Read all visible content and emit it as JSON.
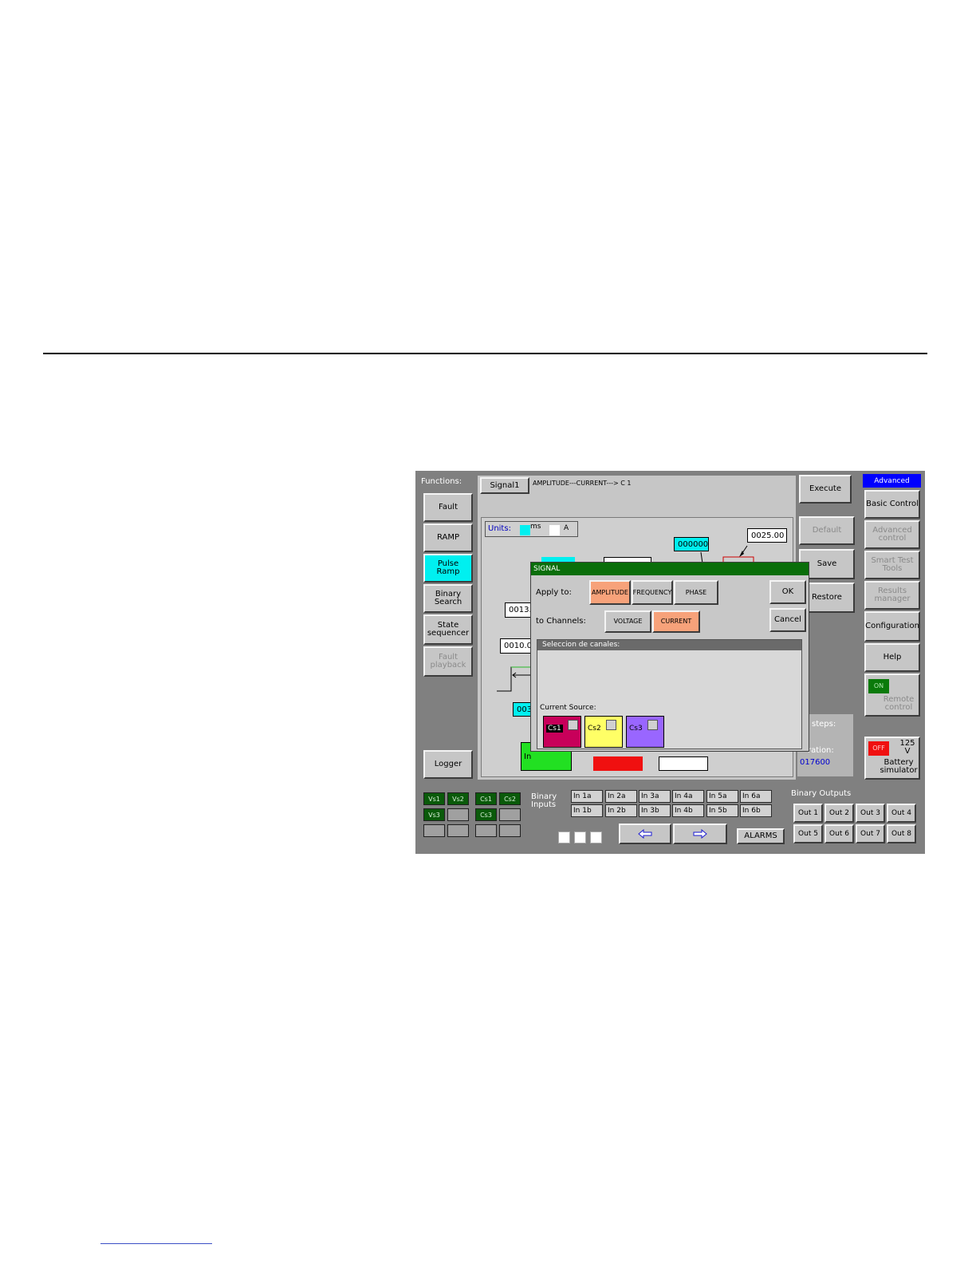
{
  "functions": {
    "title": "Functions:",
    "items": [
      {
        "label": "Fault",
        "state": "normal"
      },
      {
        "label": "RAMP",
        "state": "normal"
      },
      {
        "label": "Pulse Ramp",
        "state": "selected"
      },
      {
        "label": "Binary Search",
        "state": "normal"
      },
      {
        "label": "State sequencer",
        "state": "normal"
      },
      {
        "label": "Fault playback",
        "state": "disabled"
      }
    ],
    "logger": "Logger"
  },
  "header": {
    "signal_button": "Signal1",
    "path_text": "AMPLITUDE---CURRENT---> C 1"
  },
  "actions": {
    "execute": "Execute",
    "default": "Default",
    "save": "Save",
    "restore": "Restore"
  },
  "units": {
    "label": "Units:",
    "time_unit": "ms",
    "value_unit": "A"
  },
  "diagram": {
    "field_top_cyan": "000000",
    "field_top_right": "0025.00",
    "field_left_1": "0013.",
    "field_left_2": "0010.0",
    "field_left_3": "003",
    "box_letter": "In"
  },
  "info_panel": {
    "steps_label": "steps:",
    "duration_label": "ration:",
    "duration_value": "017600"
  },
  "right_menu": {
    "mode": "Advanced",
    "items": [
      {
        "label": "Basic Control",
        "state": "normal"
      },
      {
        "label": "Advanced control",
        "state": "disabled"
      },
      {
        "label": "Smart Test Tools",
        "state": "disabled"
      },
      {
        "label": "Results manager",
        "state": "disabled"
      },
      {
        "label": "Configuration",
        "state": "normal"
      },
      {
        "label": "Help",
        "state": "normal"
      }
    ],
    "remote": {
      "indicator": "ON",
      "label": "Remote control"
    },
    "battery": {
      "indicator": "OFF",
      "voltage": "125 V",
      "label": "Battery simulator"
    }
  },
  "dialog": {
    "title": "SIGNAL",
    "apply_to_label": "Apply to:",
    "apply_options": [
      {
        "label": "AMPLITUDE",
        "selected": true
      },
      {
        "label": "FREQUENCY",
        "selected": false
      },
      {
        "label": "PHASE",
        "selected": false
      }
    ],
    "channels_label": "to Channels:",
    "channel_options": [
      {
        "label": "VOLTAGE",
        "selected": false
      },
      {
        "label": "CURRENT",
        "selected": true
      }
    ],
    "ok": "OK",
    "cancel": "Cancel",
    "group_title": "Seleccion de canales:",
    "source_label": "Current Source:",
    "sources": [
      {
        "label": "Cs1",
        "color": "#c8005a",
        "highlighted": true
      },
      {
        "label": "Cs2",
        "color": "#ffff66",
        "highlighted": false
      },
      {
        "label": "Cs3",
        "color": "#9966ff",
        "highlighted": false
      }
    ]
  },
  "status": {
    "voltage_sources": [
      "Vs1",
      "Vs2",
      "Vs3"
    ],
    "current_sources": [
      "Cs1",
      "Cs2",
      "Cs3"
    ],
    "binary_inputs_label": "Binary Inputs",
    "binary_inputs": [
      "In 1a",
      "In 2a",
      "In 3a",
      "In 4a",
      "In 5a",
      "In 6a",
      "In 1b",
      "In 2b",
      "In 3b",
      "In 4b",
      "In 5b",
      "In 6b"
    ],
    "binary_outputs_label": "Binary Outputs",
    "binary_outputs": [
      "Out 1",
      "Out 2",
      "Out 3",
      "Out 4",
      "Out 5",
      "Out 6",
      "Out 7",
      "Out 8"
    ],
    "alarms": "ALARMS",
    "prev_icon": "left-arrow-icon",
    "next_icon": "right-arrow-icon"
  }
}
